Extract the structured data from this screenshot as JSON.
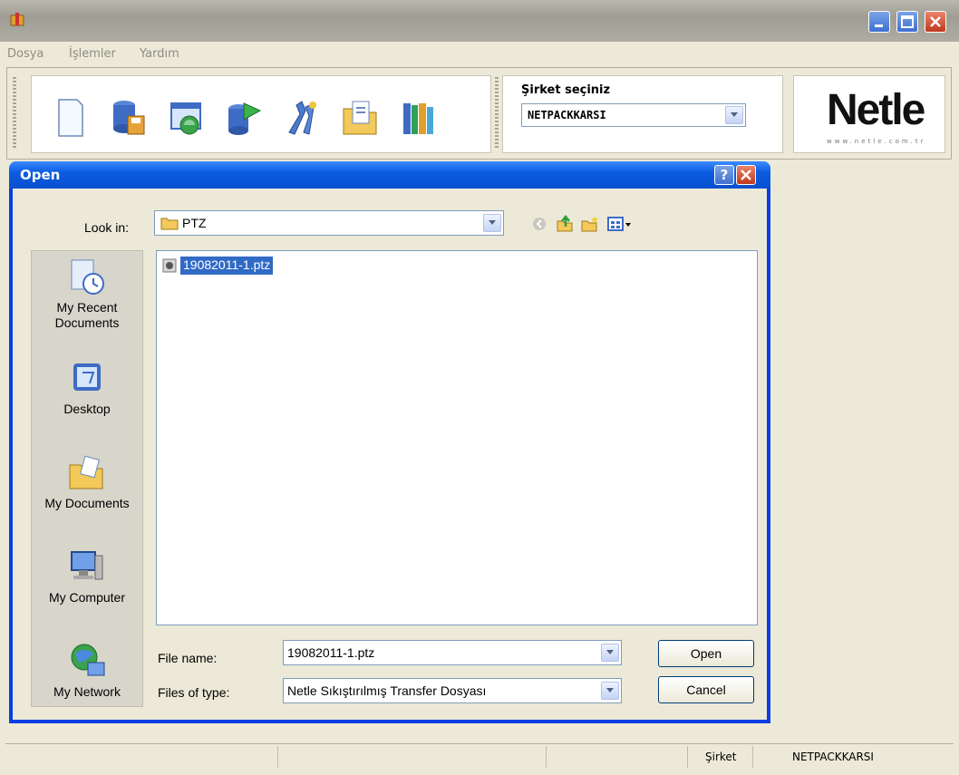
{
  "window": {
    "icon": "package-icon",
    "controls": [
      "minimize-icon",
      "maximize-icon",
      "close-icon"
    ]
  },
  "menu": {
    "items": [
      "Dosya",
      "İşlemler",
      "Yardım"
    ]
  },
  "toolbar": {
    "tools": [
      "new-document-icon",
      "database-save-icon",
      "window-image-icon",
      "database-arrow-icon",
      "tools-icon",
      "folder-file-icon",
      "books-icon"
    ]
  },
  "company": {
    "label": "Şirket seçiniz",
    "selected": "NETPACKKARSI"
  },
  "logo": {
    "text": "Netle",
    "subtext": "www.netle.com.tr"
  },
  "dialog": {
    "title": "Open",
    "help": "?",
    "look_in_label": "Look in:",
    "look_in_value": "PTZ",
    "places": [
      "My Recent Documents",
      "Desktop",
      "My Documents",
      "My Computer",
      "My Network"
    ],
    "files": [
      "19082011-1.ptz"
    ],
    "file_name_label": "File name:",
    "file_name_value": "19082011-1.ptz",
    "file_type_label": "Files of type:",
    "file_type_value": "Netle Sıkıştırılmış Transfer Dosyası",
    "open_button": "Open",
    "cancel_button": "Cancel"
  },
  "status": {
    "company_label": "Şirket",
    "company_value": "NETPACKKARSI"
  }
}
